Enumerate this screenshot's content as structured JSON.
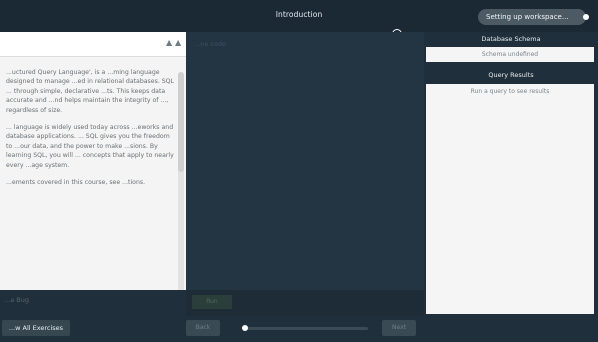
{
  "topbar": {
    "title": "Introduction",
    "status_pill": "Setting up workspace..."
  },
  "lesson": {
    "paragraphs": [
      "...uctured Query Language', is a ...ming language designed to manage ...ed in relational databases. SQL ... through simple, declarative ...ts. This keeps data accurate and ...nd helps maintain the integrity of ..., regardless of size.",
      "... language is widely used today across ...eworks and database applications. ... SQL gives you the freedom to ...our data, and the power to make ...sions. By learning SQL, you will ... concepts that apply to nearly every ...age system.",
      "...ements covered in this course, see ...tions."
    ],
    "bug_label": "...a Bug",
    "collapse_icon": "double-chevron-up-icon"
  },
  "left_bottom": {
    "all_exercises": "...w All Exercises"
  },
  "editor": {
    "placeholder": "...ne code",
    "run_label": "Run"
  },
  "navigation": {
    "back_label": "Back",
    "next_label": "Next",
    "progress_fraction": 0.02
  },
  "right_panel": {
    "schema_title": "Database Schema",
    "schema_message": "Schema undefined",
    "results_title": "Query Results",
    "results_message": "Run a query to see results"
  },
  "colors": {
    "background": "#1f2f3b",
    "topbar": "#1b2935",
    "editor": "#233542",
    "panel_light": "#f4f4f4",
    "pill": "#4b5a63"
  }
}
